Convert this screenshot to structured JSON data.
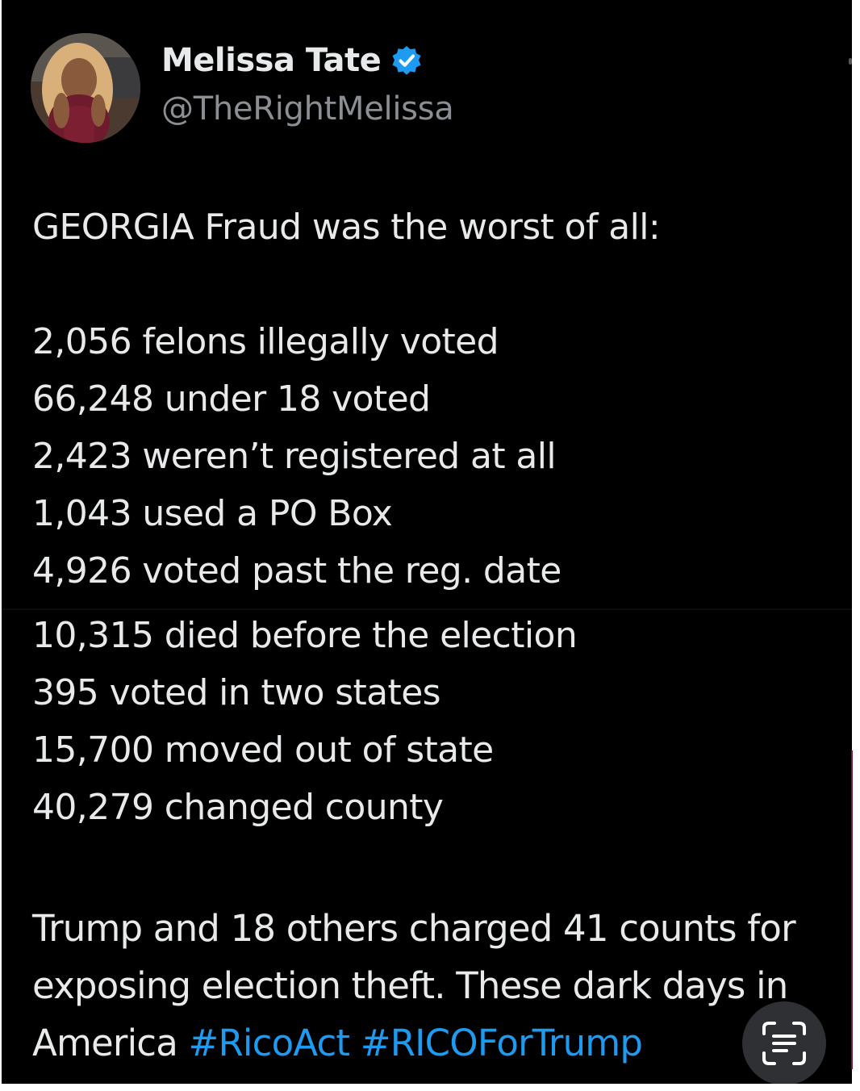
{
  "author": {
    "display_name": "Melissa Tate",
    "handle": "@TheRightMelissa",
    "verified": true
  },
  "post": {
    "headline": "GEORGIA Fraud was the worst of all:",
    "stats": [
      "2,056 felons illegally voted",
      "66,248 under 18 voted",
      "2,423 weren’t registered at all",
      "1,043 used a PO Box",
      "4,926 voted past the reg. date",
      "10,315 died before the election",
      "395 voted in two states",
      "15,700 moved out of state",
      "40,279 changed county"
    ],
    "closing_text": "Trump and 18 others charged 41 counts for exposing election theft. These dark days in America",
    "hashtags": [
      "#RicoAct",
      "#RICOForTrump"
    ]
  },
  "icons": {
    "verified": "verified-badge-icon",
    "text_scan": "text-scan-icon"
  },
  "colors": {
    "background": "#000000",
    "text": "#e7e9ea",
    "muted": "#8b8f93",
    "link": "#1d9bf0",
    "verified": "#1d9bf0"
  }
}
